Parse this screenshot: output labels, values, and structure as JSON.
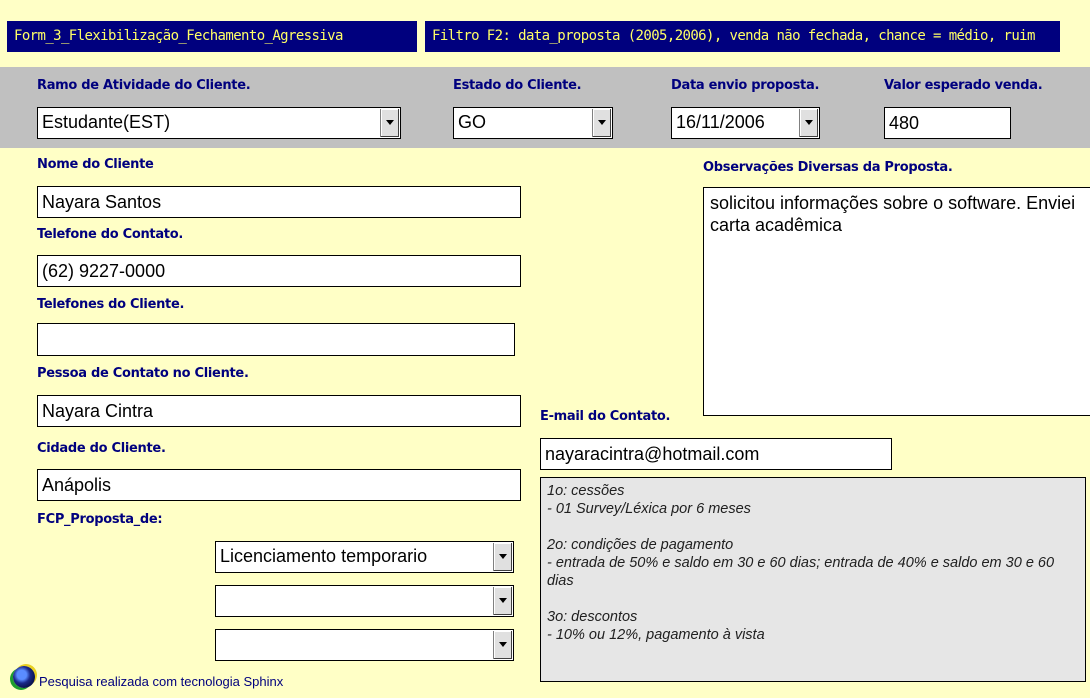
{
  "header": {
    "form_title": "Form_3_Flexibilização_Fechamento_Agressiva",
    "filter_text": "Filtro F2: data_proposta (2005,2006), venda não fechada, chance = médio, ruim"
  },
  "top_fields": {
    "ramo_label": "Ramo de Atividade do Cliente.",
    "ramo_value": "Estudante(EST)",
    "estado_label": "Estado do Cliente.",
    "estado_value": "GO",
    "data_label": "Data envio proposta.",
    "data_value": "16/11/2006",
    "valor_label": "Valor esperado venda.",
    "valor_value": "480"
  },
  "left": {
    "nome_label": "Nome do Cliente",
    "nome_value": "Nayara Santos",
    "tel_contato_label": "Telefone do Contato.",
    "tel_contato_value": "(62) 9227-0000",
    "tel_cliente_label": "Telefones do Cliente.",
    "tel_cliente_value": "",
    "pessoa_label": "Pessoa de Contato no Cliente.",
    "pessoa_value": "Nayara Cintra",
    "cidade_label": "Cidade do Cliente.",
    "cidade_value": "Anápolis",
    "fcp_label": "FCP_Proposta_de:",
    "fcp_values": [
      "Licenciamento temporario",
      "",
      ""
    ]
  },
  "right": {
    "obs_label": "Observações Diversas da Proposta.",
    "obs_value": "solicitou informações sobre o software. Enviei carta acadêmica",
    "email_label": "E-mail do Contato.",
    "email_value": "nayaracintra@hotmail.com",
    "notes": "1o: cessões\n- 01 Survey/Léxica por 6 meses\n\n2o: condições de pagamento\n- entrada de 50% e saldo em 30 e 60 dias; entrada de 40% e saldo em 30 e 60 dias\n\n3o: descontos\n- 10% ou 12%, pagamento à vista"
  },
  "footer": {
    "text": "Pesquisa realizada com tecnologia Sphinx",
    "icon": "sphinx-logo-icon"
  },
  "colors": {
    "background": "#FFFFC6",
    "header_bg": "#00007E",
    "header_text": "#FFFF66",
    "label_text": "#00007E",
    "band_bg": "#C0C0C0"
  }
}
